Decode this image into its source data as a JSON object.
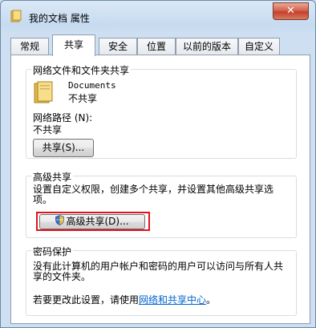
{
  "window": {
    "title": "我的文档 属性",
    "close_glyph": "✕"
  },
  "tabs": [
    "常规",
    "共享",
    "安全",
    "位置",
    "以前的版本",
    "自定义"
  ],
  "sharing_group": {
    "title": "网络文件和文件夹共享",
    "folder_name": "Documents",
    "folder_status": "不共享",
    "path_label": "网络路径 (N):",
    "path_value": "不共享",
    "share_button": "共享(S)..."
  },
  "advanced_group": {
    "title": "高级共享",
    "description": "设置自定义权限，创建多个共享，并设置其他高级共享选项。",
    "advanced_button": "高级共享(D)...",
    "highlight_color": "#e0141e"
  },
  "password_group": {
    "title": "密码保护",
    "description": "没有此计算机的用户帐户和密码的用户可以访问与所有人共享的文件夹。",
    "change_prefix": "若要更改此设置，请使用",
    "link_text": "网络和共享中心",
    "change_suffix": "。"
  },
  "icons": [
    "folder-icon",
    "shield-icon",
    "close-icon"
  ]
}
